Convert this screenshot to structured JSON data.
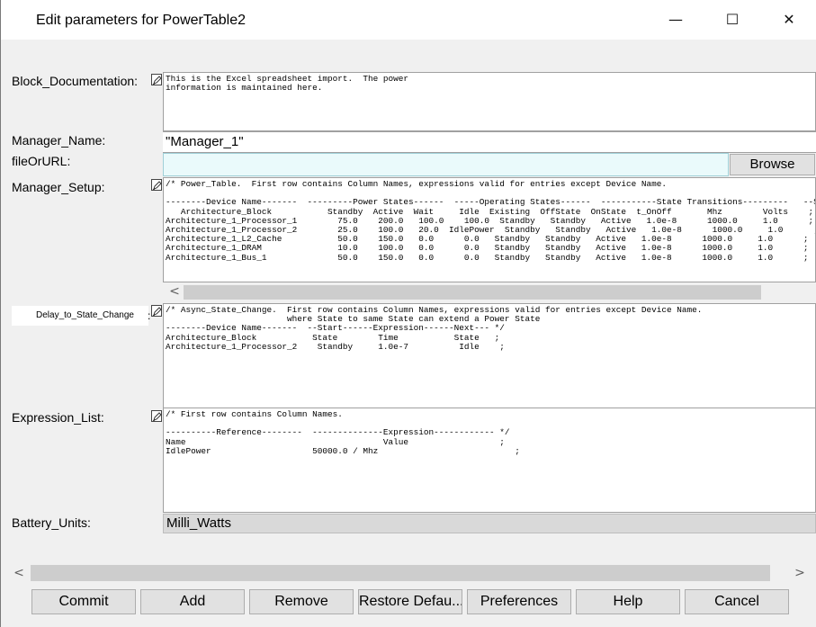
{
  "window": {
    "title": "Edit parameters for PowerTable2",
    "controls": {
      "minimize": "—",
      "maximize": "☐",
      "close": "✕"
    }
  },
  "labels": {
    "block_documentation": "Block_Documentation:",
    "manager_name": "Manager_Name:",
    "file_or_url": "fileOrURL:",
    "manager_setup": "Manager_Setup:",
    "delay_to_state_change": "Delay_to_State_Change",
    "delay_colon": ":",
    "expression_list": "Expression_List:",
    "battery_units": "Battery_Units:"
  },
  "fields": {
    "block_documentation": "This is the Excel spreadsheet import.  The power\ninformation is maintained here.",
    "manager_name": "\"Manager_1\"",
    "file_or_url": "",
    "manager_setup": "/* Power_Table.  First row contains Column Names, expressions valid for entries except Device Name.\n\n--------Device Name-------  ---------Power States------  -----Operating States------  -----------State Transitions---------   --Speed\n   Architecture_Block           Standby  Active  Wait     Idle  Existing  OffState  OnState  t_OnOff       Mhz        Volts    ;\nArchitecture_1_Processor_1        75.0    200.0   100.0    100.0  Standby   Standby   Active   1.0e-8      1000.0     1.0      ;\nArchitecture_1_Processor_2        25.0    100.0   20.0  IdlePower  Standby   Standby   Active   1.0e-8      1000.0     1.0      ;\nArchitecture_1_L2_Cache           50.0    150.0   0.0      0.0   Standby   Standby   Active   1.0e-8      1000.0     1.0      ;\nArchitecture_1_DRAM               10.0    100.0   0.0      0.0   Standby   Standby   Active   1.0e-8      1000.0     1.0      ;\nArchitecture_1_Bus_1              50.0    150.0   0.0      0.0   Standby   Standby   Active   1.0e-8      1000.0     1.0      ;",
    "delay_to_state_change": "/* Async_State_Change.  First row contains Column Names, expressions valid for entries except Device Name.\n                        where State to same State can extend a Power State\n--------Device Name-------  --Start------Expression------Next--- */\nArchitecture_Block           State        Time           State   ;\nArchitecture_1_Processor_2    Standby     1.0e-7          Idle    ;",
    "expression_list": "/* First row contains Column Names.\n\n----------Reference--------  --------------Expression------------ */\nName                                       Value                  ;\nIdlePower                    50000.0 / Mhz                           ;",
    "battery_units": "Milli_Watts"
  },
  "buttons": {
    "browse": "Browse",
    "commit": "Commit",
    "add": "Add",
    "remove": "Remove",
    "restore_defaults": "Restore Defau...",
    "preferences": "Preferences",
    "help": "Help",
    "cancel": "Cancel"
  },
  "scroll": {
    "left_arrow": "<",
    "right_arrow": ">"
  },
  "icons": {
    "edit": "edit-pencil-icon"
  }
}
